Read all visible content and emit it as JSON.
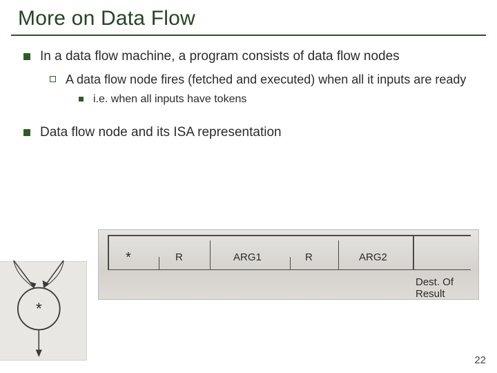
{
  "title": "More on Data Flow",
  "bullets": {
    "b1": "In a data flow machine, a program consists of data flow nodes",
    "b1a": "A data flow node fires (fetched and executed) when all it inputs are ready",
    "b1a_i": "i.e. when all inputs have tokens",
    "b2": "Data flow node and its ISA representation"
  },
  "node_diagram": {
    "operator": "*"
  },
  "isa": {
    "field1": "*",
    "field2": "R",
    "field3": "ARG1",
    "field4": "R",
    "field5": "ARG2",
    "field6": "Dest. Of Result"
  },
  "page_number": "22"
}
